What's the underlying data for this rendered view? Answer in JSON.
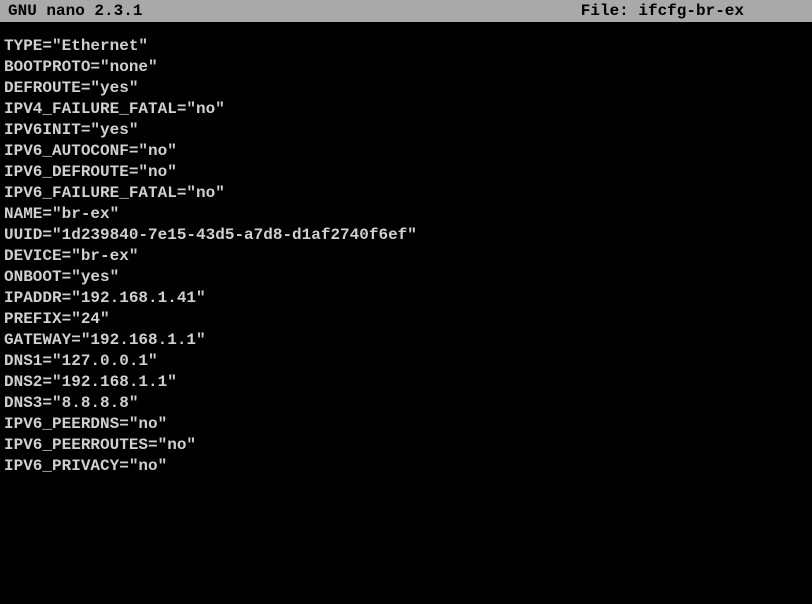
{
  "titlebar": {
    "app_label": "  GNU nano  2.3.1",
    "file_label": "File: ifcfg-br-ex"
  },
  "editor": {
    "lines": [
      "TYPE=\"Ethernet\"",
      "BOOTPROTO=\"none\"",
      "DEFROUTE=\"yes\"",
      "IPV4_FAILURE_FATAL=\"no\"",
      "IPV6INIT=\"yes\"",
      "IPV6_AUTOCONF=\"no\"",
      "IPV6_DEFROUTE=\"no\"",
      "IPV6_FAILURE_FATAL=\"no\"",
      "NAME=\"br-ex\"",
      "UUID=\"1d239840-7e15-43d5-a7d8-d1af2740f6ef\"",
      "DEVICE=\"br-ex\"",
      "ONBOOT=\"yes\"",
      "IPADDR=\"192.168.1.41\"",
      "PREFIX=\"24\"",
      "GATEWAY=\"192.168.1.1\"",
      "DNS1=\"127.0.0.1\"",
      "DNS2=\"192.168.1.1\"",
      "DNS3=\"8.8.8.8\"",
      "IPV6_PEERDNS=\"no\"",
      "IPV6_PEERROUTES=\"no\"",
      "IPV6_PRIVACY=\"no\""
    ]
  }
}
